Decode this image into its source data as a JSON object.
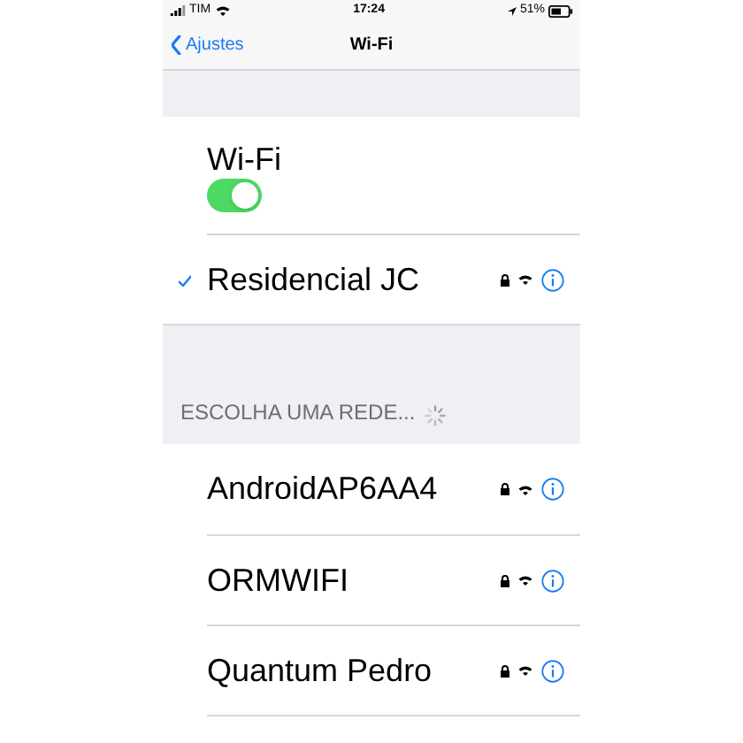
{
  "status_bar": {
    "carrier": "TIM",
    "time": "17:24",
    "battery": "51%"
  },
  "nav": {
    "back": "Ajustes",
    "title": "Wi-Fi"
  },
  "wifi": {
    "label": "Wi-Fi",
    "on": true
  },
  "connected": {
    "name": "Residencial JC",
    "selected": true,
    "locked": true
  },
  "section_header": "ESCOLHA UMA REDE...",
  "networks": [
    {
      "name": "AndroidAP6AA4",
      "locked": true
    },
    {
      "name": "ORMWIFI",
      "locked": true
    },
    {
      "name": "Quantum Pedro",
      "locked": true
    }
  ]
}
